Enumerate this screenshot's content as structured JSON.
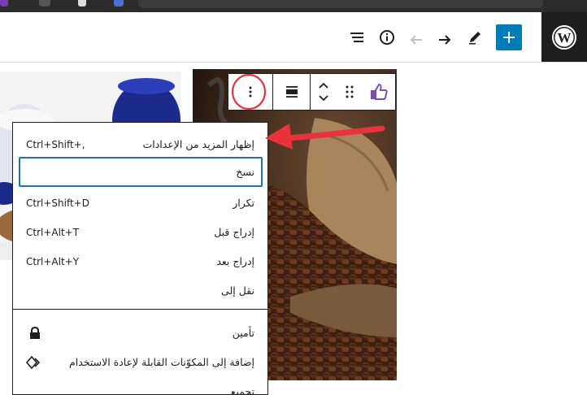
{
  "toolbar": {
    "options_tooltip": "Options"
  },
  "menu": {
    "items": [
      {
        "label": "إظهار المزيد من الإعدادات",
        "shortcut": "Ctrl+Shift+,"
      },
      {
        "label": "نسخ",
        "shortcut": ""
      },
      {
        "label": "تكرار",
        "shortcut": "Ctrl+Shift+D"
      },
      {
        "label": "إدراج قبل",
        "shortcut": "Ctrl+Alt+T"
      },
      {
        "label": "إدراج بعد",
        "shortcut": "Ctrl+Alt+Y"
      },
      {
        "label": "نقل إلى",
        "shortcut": ""
      },
      {
        "label": "تأمين",
        "shortcut": ""
      },
      {
        "label": "إضافة إلى المكوّنات القابلة لإعادة الاستخدام",
        "shortcut": ""
      },
      {
        "label": "تجميع",
        "shortcut": ""
      }
    ]
  },
  "icons": {
    "logo": "wordpress-logo-icon",
    "add": "plus-icon",
    "edit": "pencil-icon",
    "redo": "redo-icon",
    "undo": "undo-icon",
    "info": "info-icon",
    "outline": "list-view-icon",
    "options": "more-vertical-icon",
    "align": "align-icon",
    "move": "move-arrows-icon",
    "drag": "drag-handle-icon",
    "block_type": "thumbs-up-icon",
    "lock": "lock-icon",
    "reusable": "reusable-block-icon"
  },
  "colors": {
    "accent": "#007cba",
    "annotation": "#e8323c",
    "wp_dark": "#1e1e1e",
    "focus_ring": "#2271b1",
    "block_icon": "#7b4fb0"
  }
}
